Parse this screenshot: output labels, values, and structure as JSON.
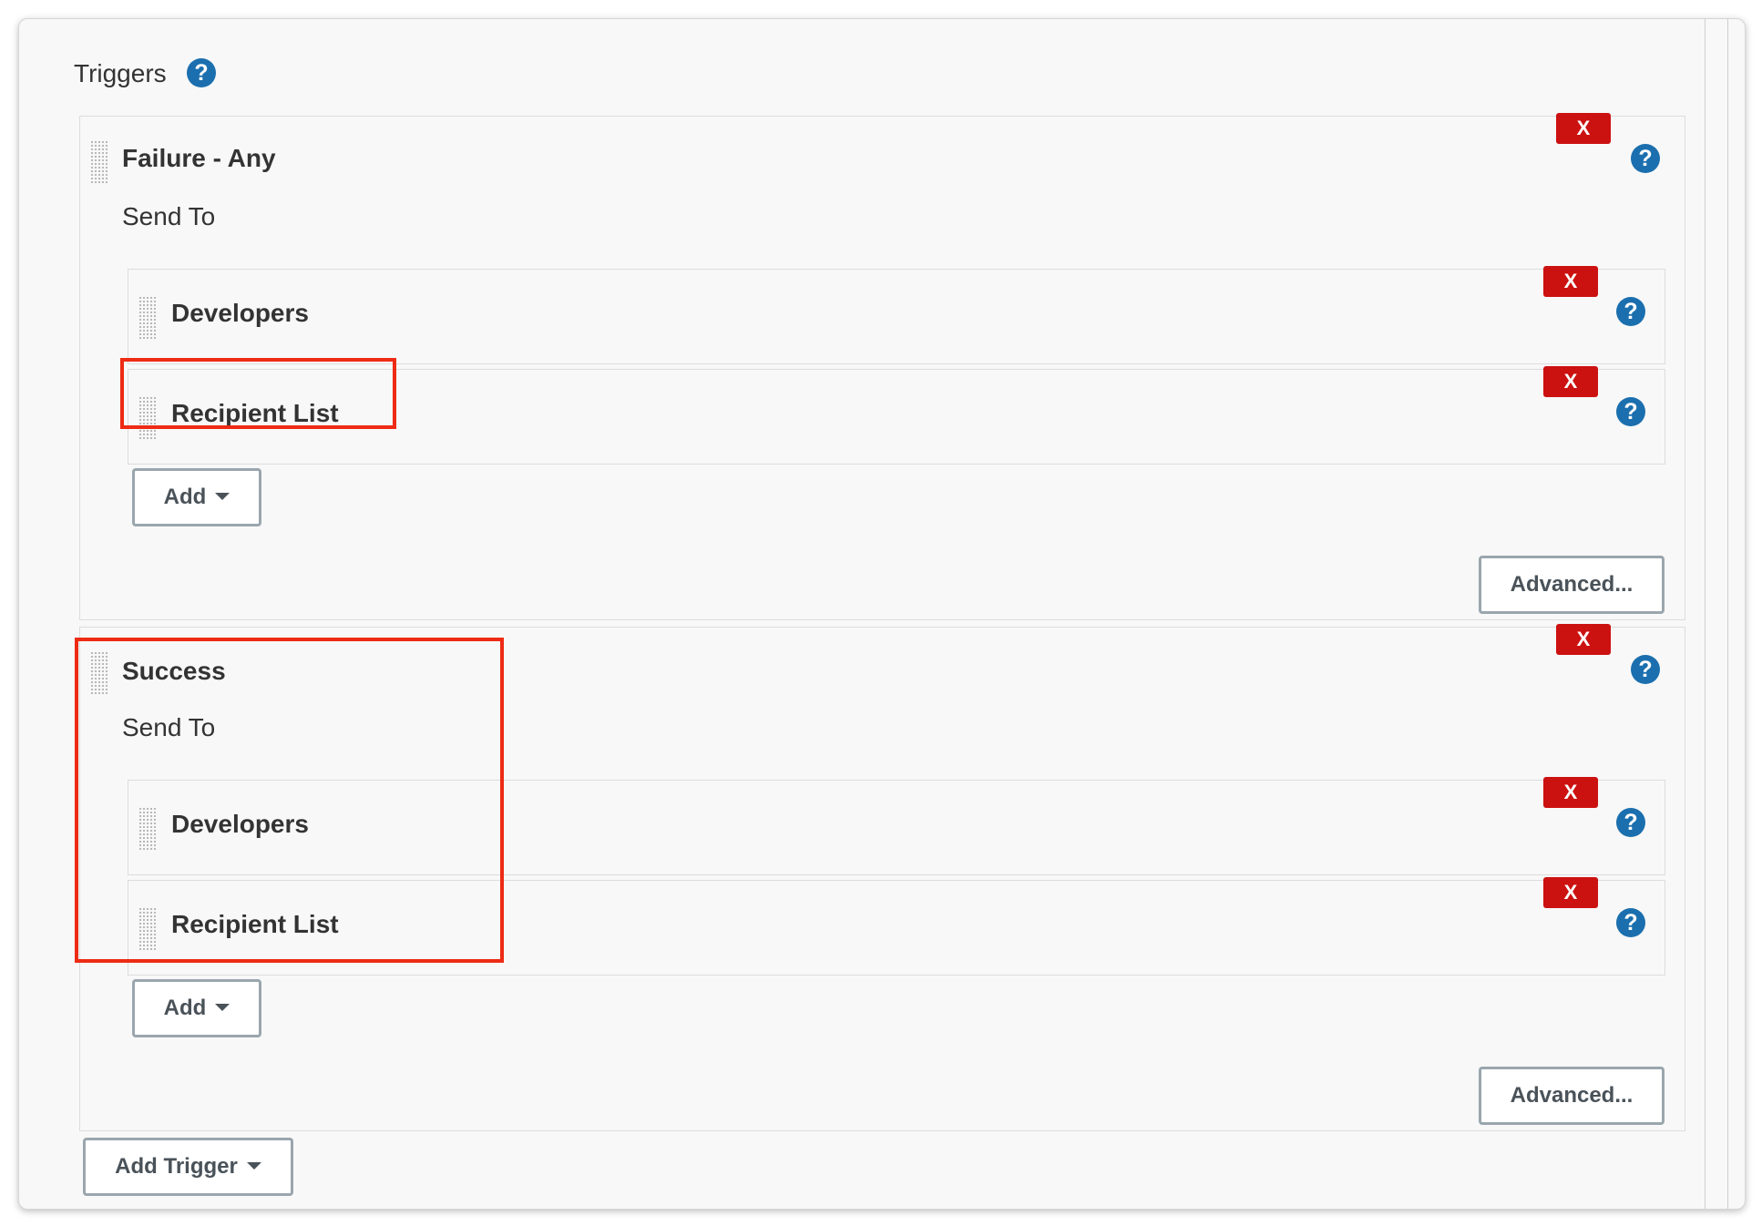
{
  "section": {
    "title": "Triggers",
    "help_icon": "?"
  },
  "triggers": [
    {
      "name": "Failure - Any",
      "send_to_label": "Send To",
      "remove_label": "X",
      "help_icon": "?",
      "recipients": [
        {
          "name": "Developers",
          "remove_label": "X",
          "help_icon": "?"
        },
        {
          "name": "Recipient List",
          "remove_label": "X",
          "help_icon": "?"
        }
      ],
      "add_label": "Add",
      "advanced_label": "Advanced..."
    },
    {
      "name": "Success",
      "send_to_label": "Send To",
      "remove_label": "X",
      "help_icon": "?",
      "recipients": [
        {
          "name": "Developers",
          "remove_label": "X",
          "help_icon": "?"
        },
        {
          "name": "Recipient List",
          "remove_label": "X",
          "help_icon": "?"
        }
      ],
      "add_label": "Add",
      "advanced_label": "Advanced..."
    }
  ],
  "add_trigger_label": "Add Trigger",
  "colors": {
    "help": "#1b6fae",
    "remove": "#cc1111",
    "highlight": "#ee2b14",
    "panel": "#f8f8f8"
  },
  "icons": {
    "help": "help-icon",
    "remove": "close-icon",
    "dropdown": "caret-down-icon",
    "drag": "drag-handle-icon"
  }
}
